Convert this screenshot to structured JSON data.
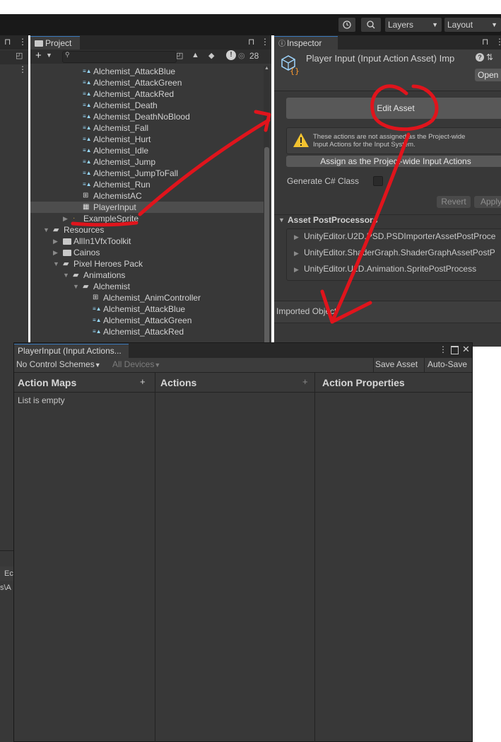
{
  "toolbar": {
    "history_icon": "history-icon",
    "search_icon": "search-icon",
    "layers_label": "Layers",
    "layout_label": "Layout"
  },
  "left_strip": {
    "lock_icon": "lock-icon",
    "more_icon": "kebab-icon",
    "lower_tab": "Ec",
    "lower_path": "s\\A"
  },
  "project": {
    "tab_label": "Project",
    "add_label": "+",
    "visible_count": "28",
    "tree": [
      {
        "label": "Alchemist_AttackBlue",
        "icon": "anim"
      },
      {
        "label": "Alchemist_AttackGreen",
        "icon": "anim"
      },
      {
        "label": "Alchemist_AttackRed",
        "icon": "anim"
      },
      {
        "label": "Alchemist_Death",
        "icon": "anim"
      },
      {
        "label": "Alchemist_DeathNoBlood",
        "icon": "anim"
      },
      {
        "label": "Alchemist_Fall",
        "icon": "anim"
      },
      {
        "label": "Alchemist_Hurt",
        "icon": "anim"
      },
      {
        "label": "Alchemist_Idle",
        "icon": "anim"
      },
      {
        "label": "Alchemist_Jump",
        "icon": "anim"
      },
      {
        "label": "Alchemist_JumpToFall",
        "icon": "anim"
      },
      {
        "label": "Alchemist_Run",
        "icon": "anim"
      },
      {
        "label": "AlchemistAC",
        "icon": "controller"
      },
      {
        "label": "PlayerInput",
        "icon": "input"
      },
      {
        "label": "ExampleSprite",
        "icon": "sprite"
      },
      {
        "label": "Resources",
        "icon": "ofolder"
      },
      {
        "label": "AllIn1VfxToolkit",
        "icon": "folder"
      },
      {
        "label": "Cainos",
        "icon": "folder"
      },
      {
        "label": "Pixel Heroes Pack",
        "icon": "ofolder"
      },
      {
        "label": "Animations",
        "icon": "ofolder"
      },
      {
        "label": "Alchemist",
        "icon": "ofolder"
      },
      {
        "label": "Alchemist_AnimController",
        "icon": "controller"
      },
      {
        "label": "Alchemist_AttackBlue",
        "icon": "anim"
      },
      {
        "label": "Alchemist_AttackGreen",
        "icon": "anim"
      },
      {
        "label": "Alchemist_AttackRed",
        "icon": "anim"
      }
    ]
  },
  "inspector": {
    "tab_label": "Inspector",
    "title": "Player Input (Input Action Asset) Imp",
    "open_label": "Open",
    "edit_asset_label": "Edit Asset",
    "warning_line1": "These actions are not assigned as the Project-wide",
    "warning_line2": "Input Actions for the Input System.",
    "assign_label": "Assign as the Project-wide Input Actions",
    "generate_label": "Generate C# Class",
    "revert_label": "Revert",
    "apply_label": "Apply",
    "postprocessors_label": "Asset PostProcessors",
    "postprocessors": [
      "UnityEditor.U2D.PSD.PSDImporterAssetPostProce",
      "UnityEditor.ShaderGraph.ShaderGraphAssetPostP",
      "UnityEditor.U2D.Animation.SpritePostProcess"
    ],
    "imported_label": "Imported Object"
  },
  "actions_window": {
    "title": "PlayerInput (Input Actions...",
    "control_schemes": "No Control Schemes",
    "devices": "All Devices",
    "save_label": "Save Asset",
    "autosave_label": "Auto-Save",
    "col_maps": "Action Maps",
    "col_actions": "Actions",
    "col_properties": "Action Properties",
    "add_label": "+",
    "empty_text": "List is empty"
  },
  "colors": {
    "annotation_red": "#e0141c",
    "selection_blue": "#3a79bb",
    "panel_bg": "#383838"
  }
}
